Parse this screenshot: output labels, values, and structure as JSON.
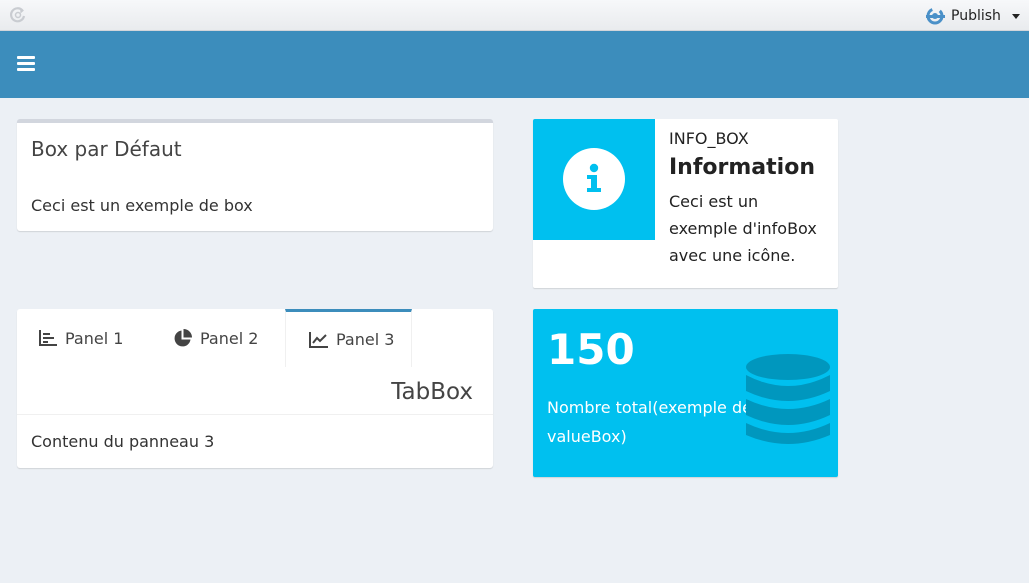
{
  "viewer": {
    "refresh_icon": "refresh-icon",
    "publish_label": "Publish",
    "publish_icon": "publish-icon"
  },
  "header": {
    "menu_icon": "hamburger-icon",
    "color": "#3c8dbc"
  },
  "default_box": {
    "title": "Box par Défaut",
    "body": "Ceci est un exemple de box"
  },
  "info_box": {
    "label": "INFO_BOX",
    "value": "Information",
    "description": "Ceci est un exemple d'infoBox avec une icône.",
    "icon": "info-icon",
    "color": "#00c0ef"
  },
  "tab_box": {
    "title": "TabBox",
    "tabs": [
      {
        "label": "Panel 1",
        "icon": "bar-chart-icon"
      },
      {
        "label": "Panel 2",
        "icon": "pie-chart-icon"
      },
      {
        "label": "Panel 3",
        "icon": "line-chart-icon"
      }
    ],
    "active_tab": "Panel 3",
    "content": "Contenu du panneau 3"
  },
  "value_box": {
    "value": "150",
    "subtitle": "Nombre total(exemple de valueBox)",
    "icon": "database-icon",
    "color": "#00c0ef"
  }
}
